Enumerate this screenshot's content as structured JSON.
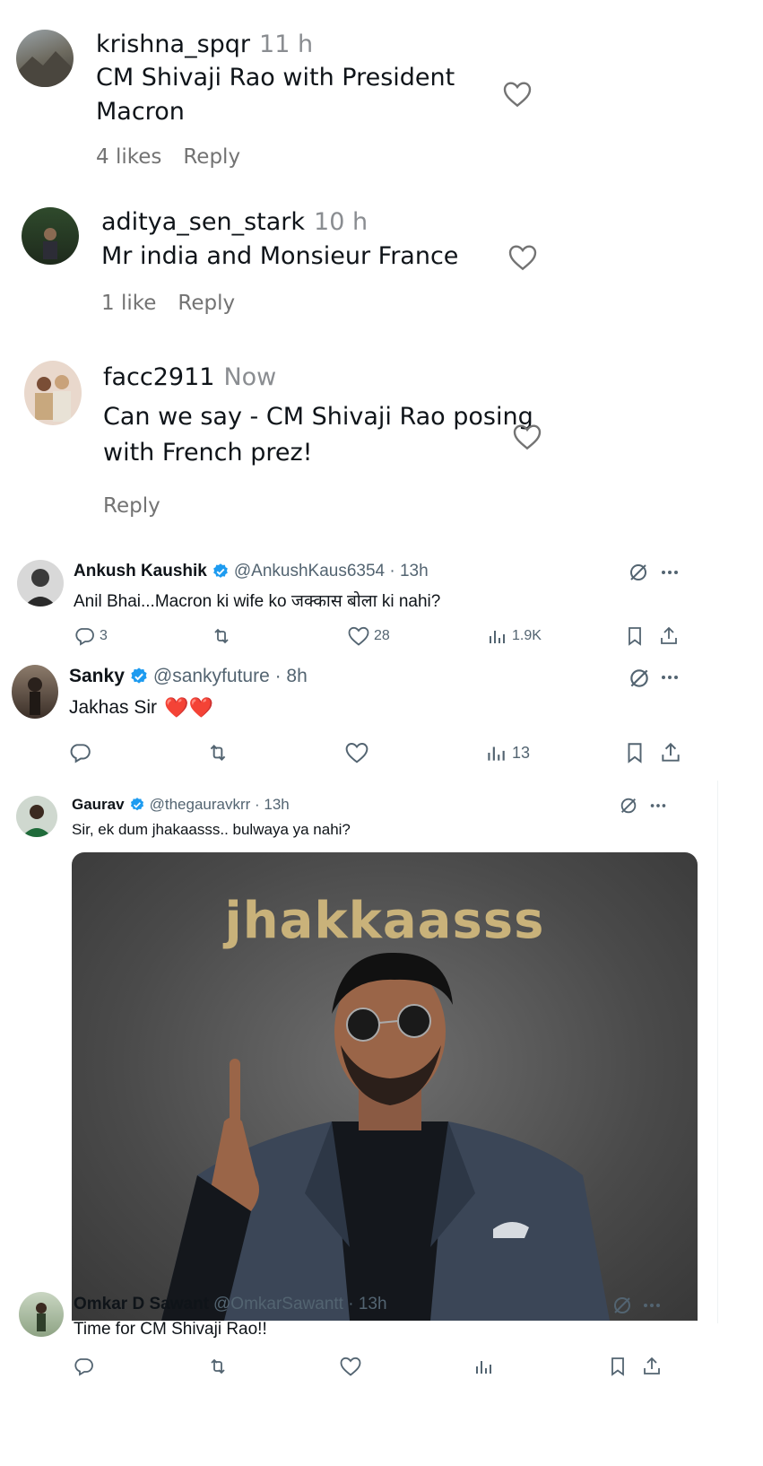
{
  "instagram_comments": [
    {
      "username": "krishna_spqr",
      "time": "11 h",
      "text_lines": [
        "CM Shivaji Rao with President",
        "Macron"
      ],
      "likes": "4 likes",
      "reply": "Reply"
    },
    {
      "username": "aditya_sen_stark",
      "time": "10 h",
      "text_lines": [
        "Mr india and Monsieur France"
      ],
      "likes": "1 like",
      "reply": "Reply"
    },
    {
      "username": "facc2911",
      "time": "Now",
      "text_lines": [
        "Can we say - CM Shivaji Rao posing",
        "with French prez!"
      ],
      "likes": "",
      "reply": "Reply"
    }
  ],
  "tweets": [
    {
      "name": "Ankush Kaushik",
      "handle": "@AnkushKaus6354 · 13h",
      "text": "Anil Bhai...Macron ki wife ko जक्कास बोला ki nahi?",
      "replies": "3",
      "retweets": "",
      "likes": "28",
      "views": "1.9K"
    },
    {
      "name": "Sanky",
      "handle": "@sankyfuture · 8h",
      "text": "Jakhas Sir",
      "emoji": "❤️❤️",
      "replies": "",
      "retweets": "",
      "likes": "",
      "views": "13"
    },
    {
      "name": "Gaurav",
      "handle": "@thegauravkrr · 13h",
      "text": "Sir, ek dum jhakaasss.. bulwaya ya nahi?",
      "media_caption": "jhakkaasss"
    },
    {
      "name": "Omkar D Sawant",
      "handle": "@OmkarSawantt · 13h",
      "text": "Time for CM Shivaji Rao!!",
      "replies": "",
      "retweets": "",
      "likes": "",
      "views": ""
    }
  ],
  "colors": {
    "verified": "#1d9bf0",
    "heart": "#e0245e",
    "muted": "#536471",
    "ig_muted": "#737373"
  }
}
